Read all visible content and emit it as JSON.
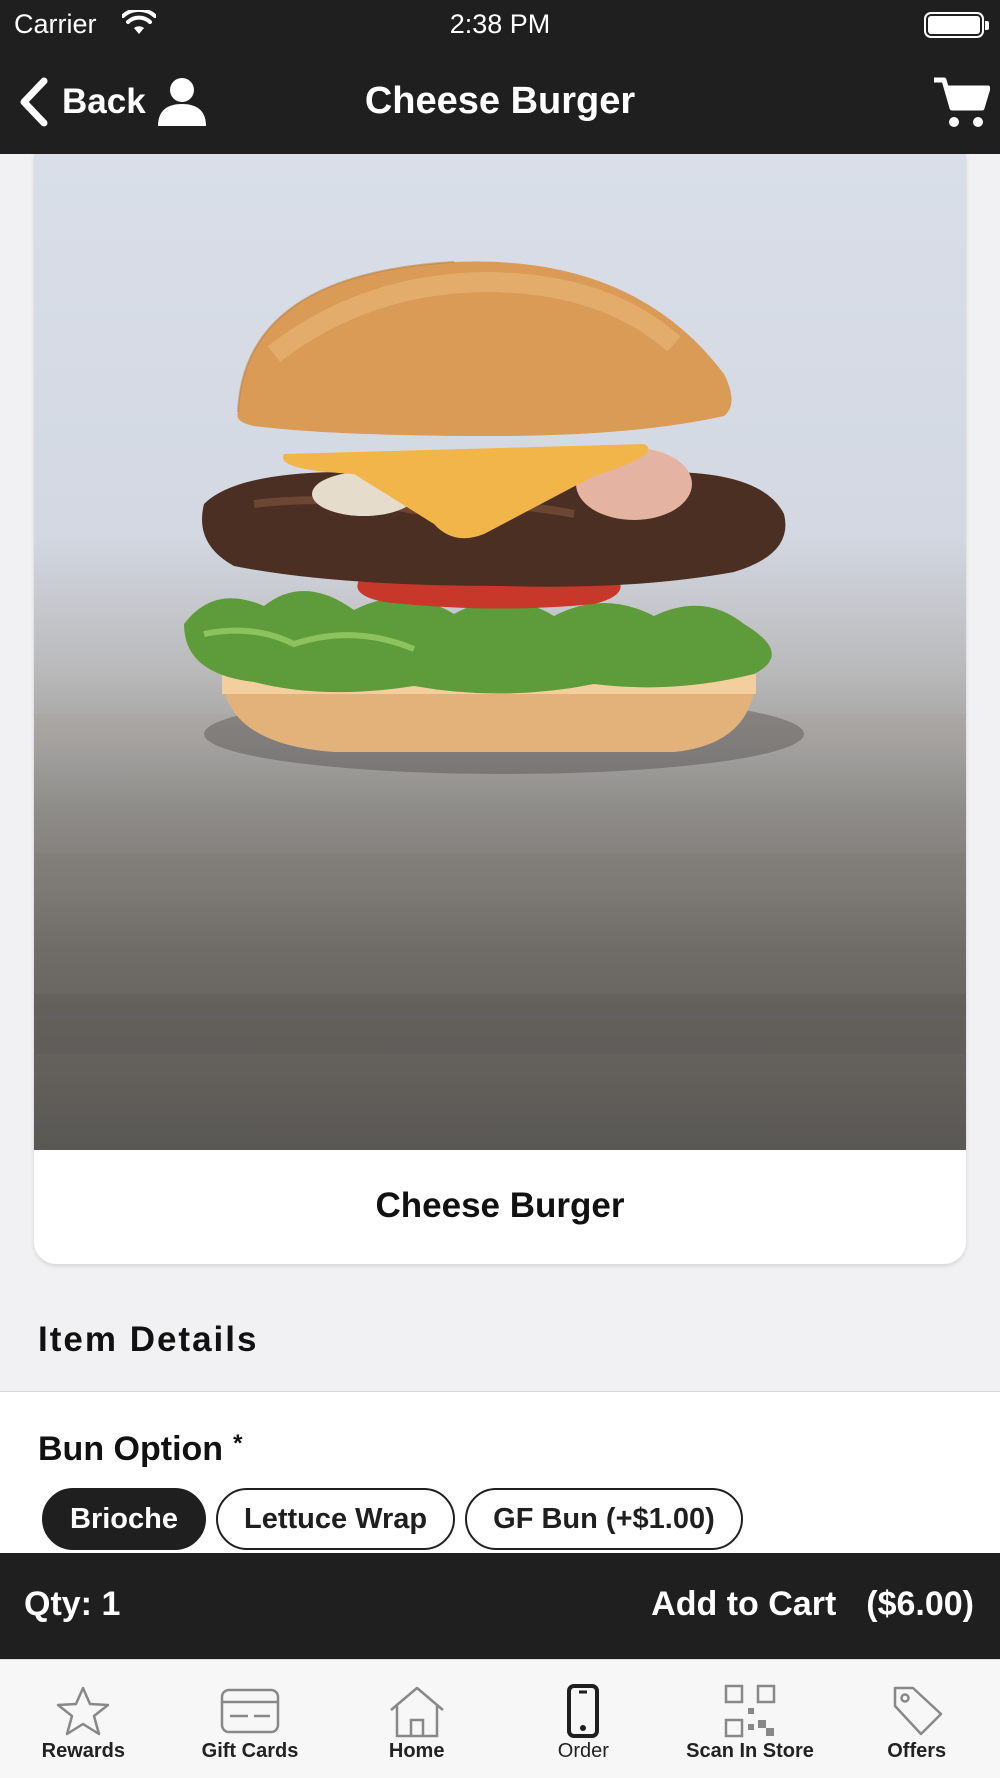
{
  "status_bar": {
    "carrier": "Carrier",
    "time": "2:38 PM"
  },
  "nav": {
    "back_label": "Back",
    "title": "Cheese Burger"
  },
  "product": {
    "name": "Cheese Burger"
  },
  "details": {
    "section_title": "Item Details"
  },
  "bun_option": {
    "label": "Bun Option",
    "required_mark": "*",
    "choices": [
      "Brioche",
      "Lettuce Wrap",
      "GF Bun (+$1.00)"
    ],
    "selected": "Brioche"
  },
  "cart_bar": {
    "qty_label": "Qty: 1",
    "add_label": "Add to Cart",
    "price": "($6.00)"
  },
  "tabs": [
    {
      "label": "Rewards",
      "icon": "star-icon"
    },
    {
      "label": "Gift Cards",
      "icon": "credit-card-icon"
    },
    {
      "label": "Home",
      "icon": "home-icon"
    },
    {
      "label": "Order",
      "icon": "phone-icon"
    },
    {
      "label": "Scan In Store",
      "icon": "qr-code-icon"
    },
    {
      "label": "Offers",
      "icon": "tag-icon"
    }
  ],
  "colors": {
    "dark": "#1f1f1f",
    "background": "#f1f1f3",
    "card": "#ffffff"
  }
}
